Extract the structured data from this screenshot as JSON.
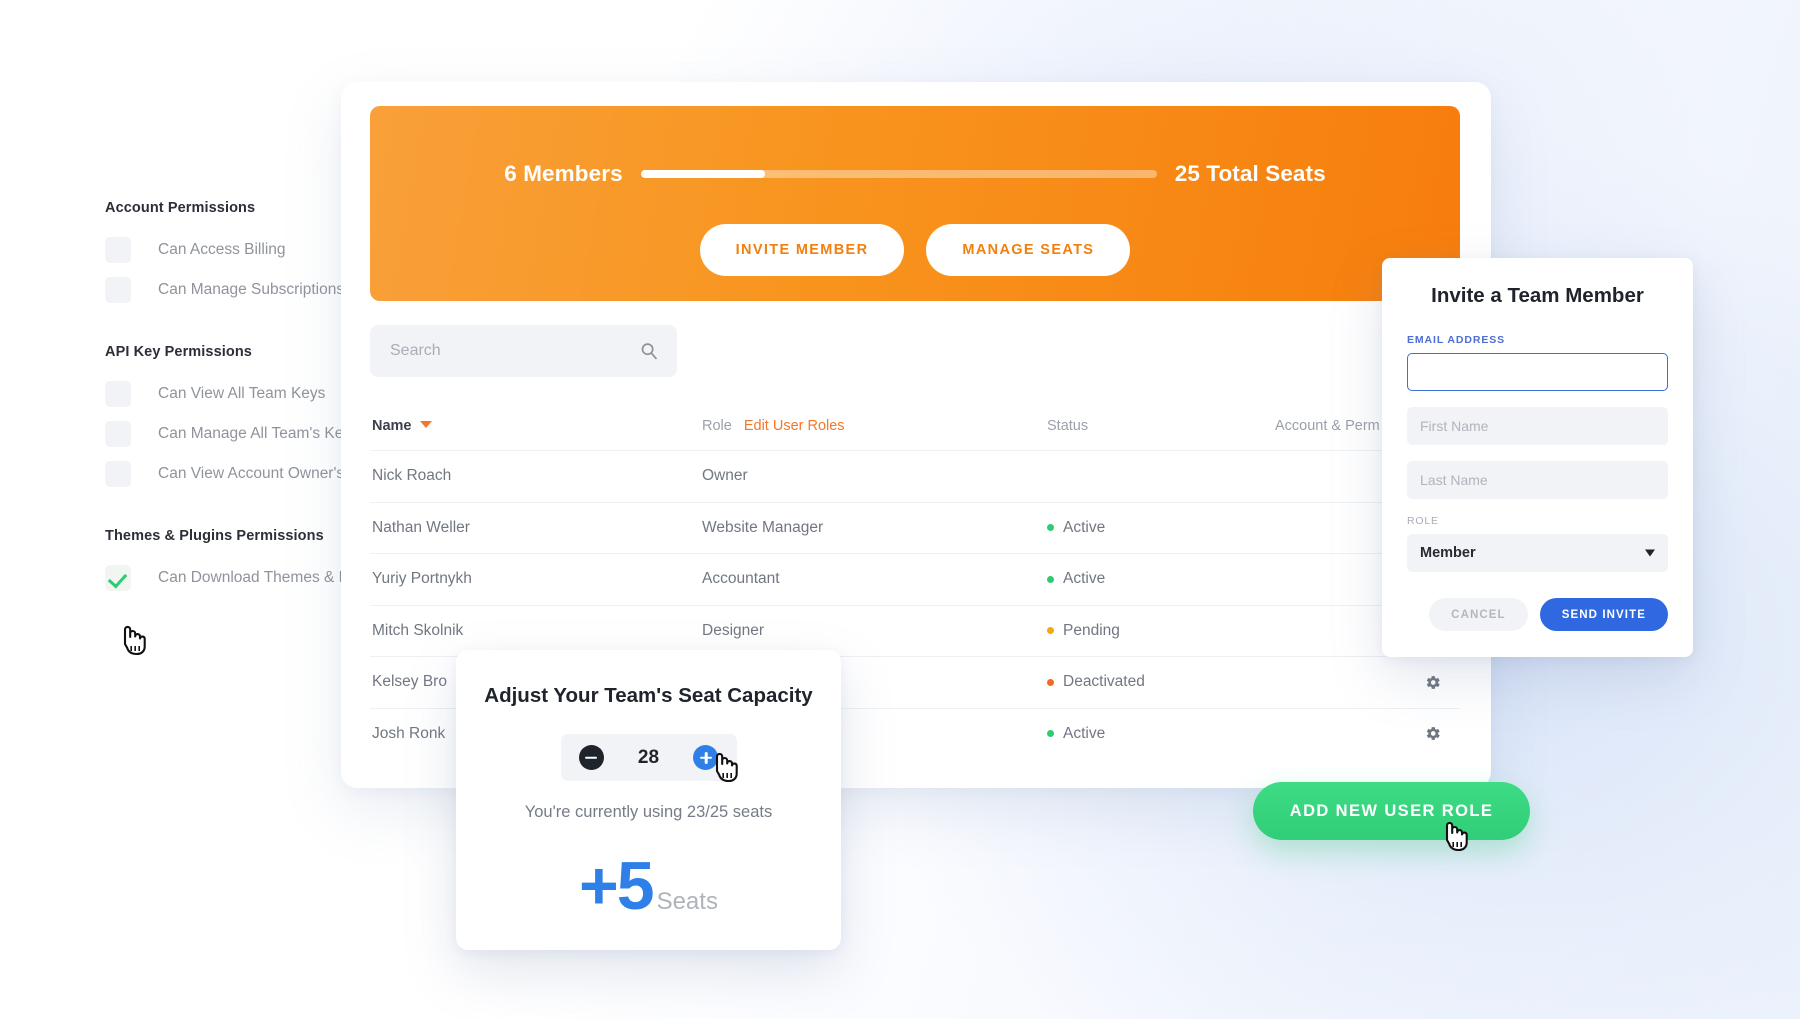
{
  "permissions_panel": {
    "groups": [
      {
        "heading": "Account Permissions",
        "items": [
          {
            "label": "Can Access Billing",
            "checked": false
          },
          {
            "label": "Can Manage Subscriptions",
            "checked": false
          }
        ]
      },
      {
        "heading": "API Key Permissions",
        "items": [
          {
            "label": "Can View All Team Keys",
            "checked": false
          },
          {
            "label": "Can Manage All Team's Keys",
            "checked": false
          },
          {
            "label": "Can View Account Owner's K",
            "checked": false
          }
        ]
      },
      {
        "heading": "Themes & Plugins Permissions",
        "items": [
          {
            "label": "Can Download Themes & Plug",
            "checked": true
          }
        ]
      }
    ]
  },
  "seat_banner": {
    "members_label": "6 Members",
    "total_seats_label": "25 Total Seats",
    "progress_percent": 24,
    "invite_member_label": "INVITE MEMBER",
    "manage_seats_label": "MANAGE SEATS",
    "accent_color": "#f7900f"
  },
  "search": {
    "placeholder": "Search",
    "value": "",
    "icon": "search-icon"
  },
  "team_table": {
    "columns": {
      "name": "Name",
      "role": "Role",
      "edit_roles_link": "Edit User Roles",
      "status": "Status",
      "account_permissions": "Account & Perm"
    },
    "rows": [
      {
        "name": "Nick Roach",
        "role": "Owner",
        "status": "",
        "status_color": "",
        "has_gear": false
      },
      {
        "name": "Nathan Weller",
        "role": "Website Manager",
        "status": "Active",
        "status_color": "#2ecc71",
        "has_gear": true
      },
      {
        "name": "Yuriy Portnykh",
        "role": "Accountant",
        "status": "Active",
        "status_color": "#2ecc71",
        "has_gear": true
      },
      {
        "name": "Mitch Skolnik",
        "role": "Designer",
        "status": "Pending",
        "status_color": "#f0a818",
        "has_gear": true
      },
      {
        "name": "Kelsey Bro",
        "role": "",
        "status": "Deactivated",
        "status_color": "#ef6c20",
        "has_gear": true
      },
      {
        "name": "Josh Ronk",
        "role": "",
        "status": "Active",
        "status_color": "#2ecc71",
        "has_gear": true
      }
    ]
  },
  "invite_modal": {
    "title": "Invite a Team Member",
    "email_label": "EMAIL ADDRESS",
    "email_value": "",
    "email_placeholder": "",
    "first_name_placeholder": "First Name",
    "first_name_value": "",
    "last_name_placeholder": "Last Name",
    "last_name_value": "",
    "role_label": "ROLE",
    "role_value": "Member",
    "cancel_label": "CANCEL",
    "send_label": "SEND INVITE",
    "focus_color": "#3d6fd6",
    "primary_color": "#2f68e0"
  },
  "seat_popup": {
    "title": "Adjust Your Team's Seat Capacity",
    "minus_label": "minus-icon",
    "value": "28",
    "plus_label": "plus-icon",
    "usage_text": "You're currently using 23/25 seats",
    "delta_number": "+5",
    "delta_label": "Seats",
    "accent_color": "#2f7fe8"
  },
  "add_role_button": {
    "label": "ADD NEW USER ROLE",
    "color": "#34d57e"
  }
}
